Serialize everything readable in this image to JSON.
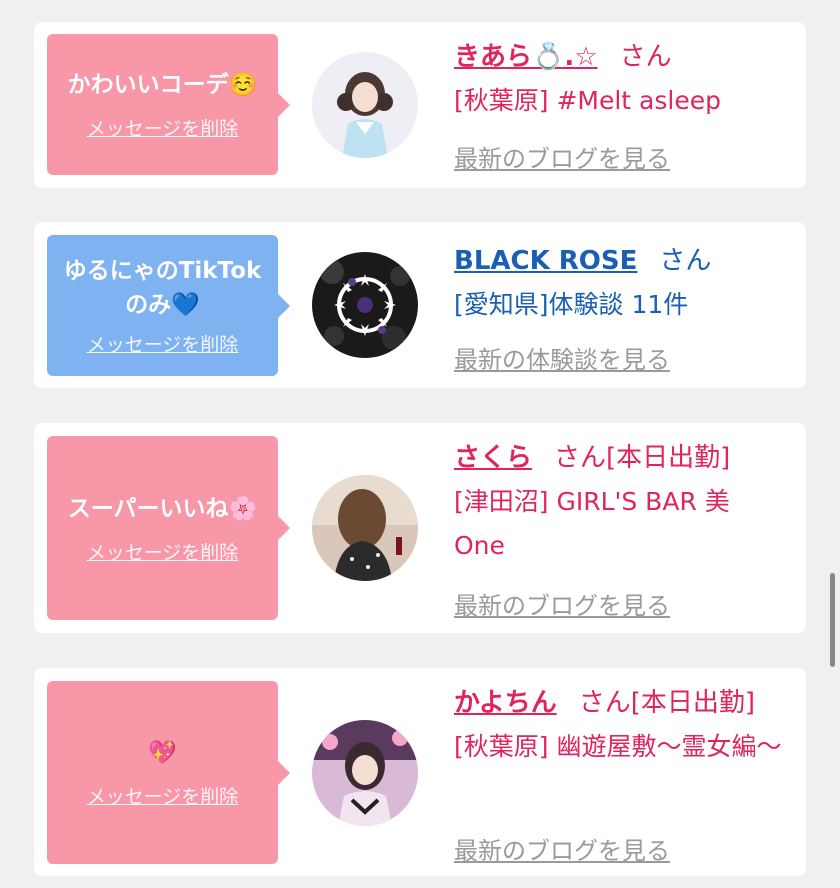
{
  "colors": {
    "pink": "#f797a7",
    "blue": "#7fb2f0",
    "pink_text": "#e0245e",
    "blue_text": "#1a5fb4",
    "gray_link": "#9a9a9a"
  },
  "cards": [
    {
      "message": "かわいいコーデ☺️",
      "delete_label": "メッセージを削除",
      "name": "きあら💍.☆",
      "san": "さん",
      "status": "",
      "detail": "[秋葉原] #Melt asleep",
      "latest_label": "最新のブログを見る"
    },
    {
      "message": "ゆるにゃのTikTokのみ💙",
      "delete_label": "メッセージを削除",
      "name": "BLACK ROSE",
      "san": "さん",
      "status": "",
      "detail": "[愛知県]体験談 11件",
      "latest_label": "最新の体験談を見る"
    },
    {
      "message": "スーパーいいね🌸",
      "delete_label": "メッセージを削除",
      "name": "さくら",
      "san": "さん",
      "status": "[本日出勤]",
      "detail": "[津田沼] GIRL'S BAR 美One",
      "latest_label": "最新のブログを見る"
    },
    {
      "message": "💖",
      "delete_label": "メッセージを削除",
      "name": "かよちん",
      "san": "さん",
      "status": "[本日出勤]",
      "detail": "[秋葉原] 幽遊屋敷～霊女編～",
      "latest_label": "最新のブログを見る"
    }
  ]
}
